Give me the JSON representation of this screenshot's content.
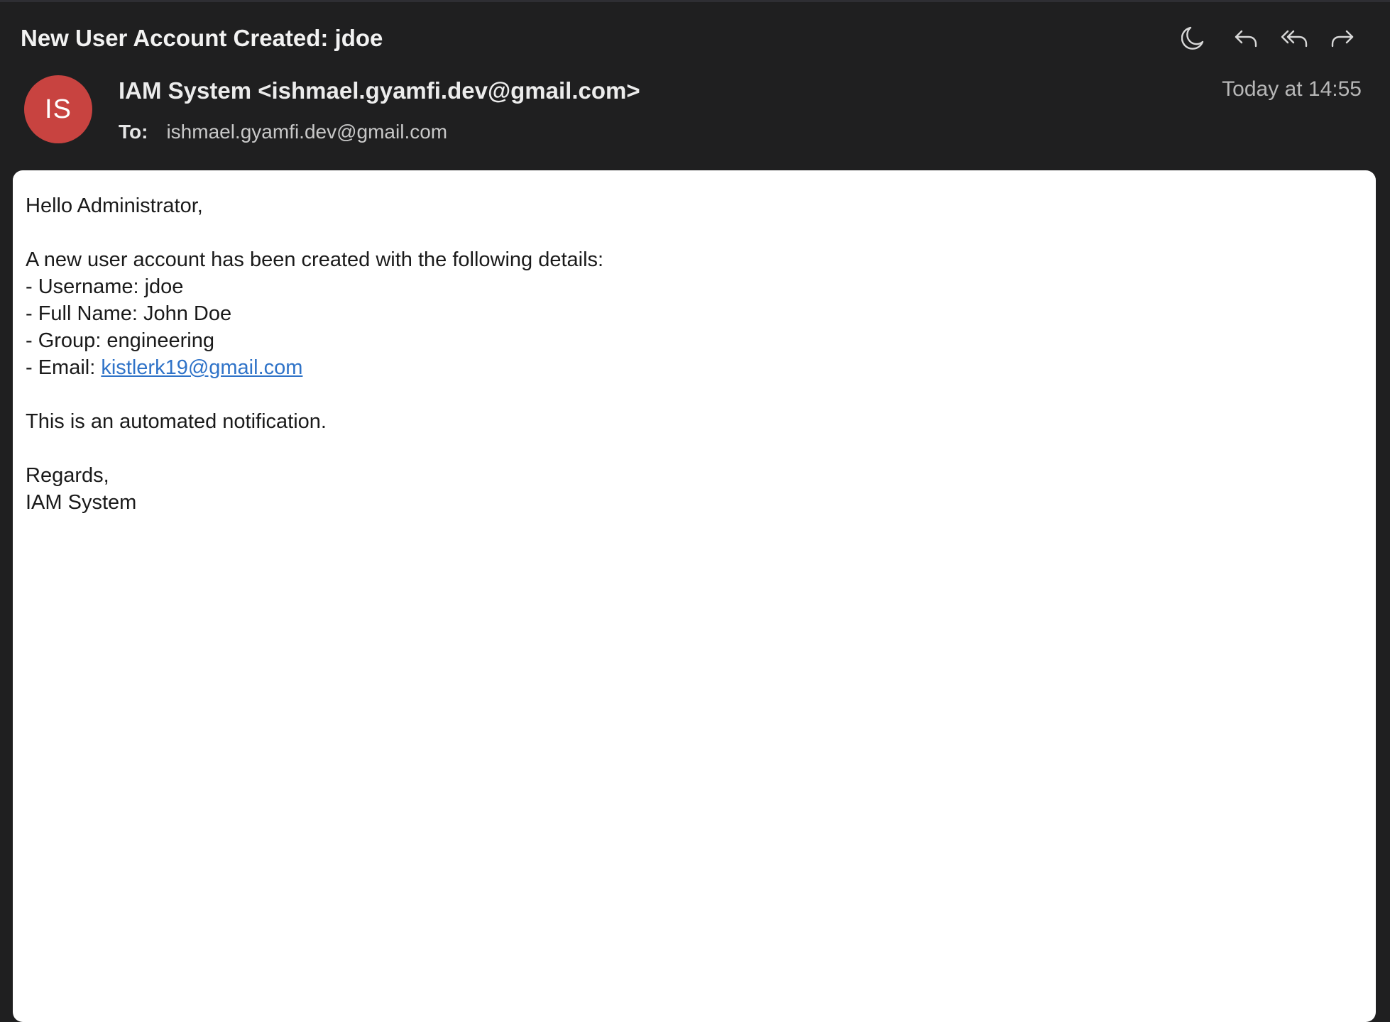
{
  "message": {
    "subject": "New User Account Created: jdoe",
    "avatar_initials": "IS",
    "sender": "IAM System <ishmael.gyamfi.dev@gmail.com>",
    "to_label": "To:",
    "to_address": "ishmael.gyamfi.dev@gmail.com",
    "timestamp": "Today at 14:55"
  },
  "toolbar": {
    "icons": [
      "moon-icon",
      "reply-icon",
      "reply-all-icon",
      "forward-icon"
    ]
  },
  "body": {
    "greeting": "Hello Administrator,",
    "intro": "A new user account has been created with the following details:",
    "username": "- Username: jdoe",
    "full_name": "- Full Name: John Doe",
    "group": "- Group: engineering",
    "email_label": "- Email: ",
    "email_link": "kistlerk19@gmail.com",
    "notice": "This is an automated notification.",
    "closing": "Regards,",
    "signature": "IAM System"
  },
  "colors": {
    "window_bg": "#1f1f20",
    "avatar_bg": "#c84340",
    "link": "#2f73c8",
    "body_bg": "#ffffff"
  }
}
